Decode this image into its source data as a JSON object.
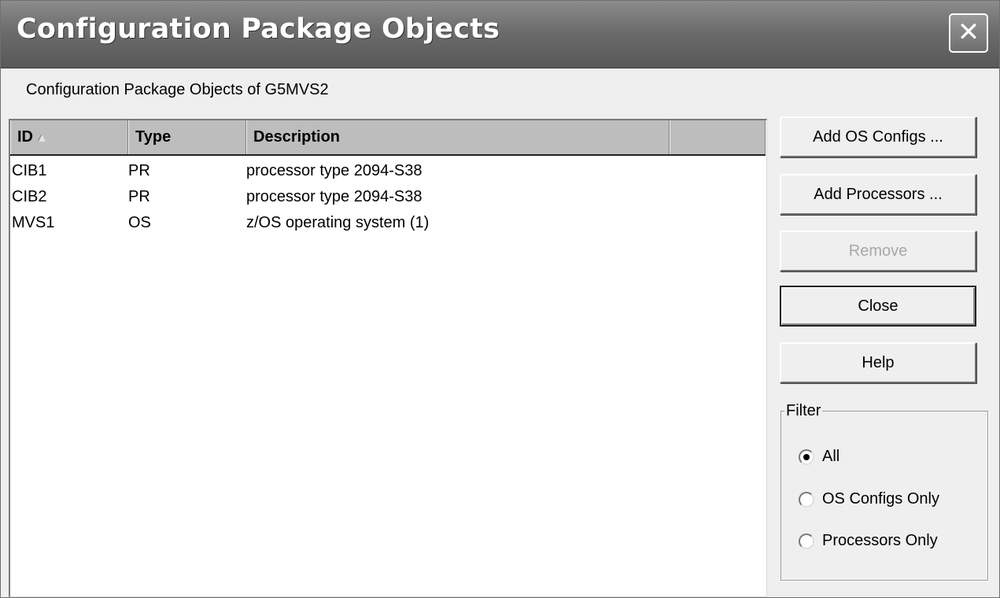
{
  "window": {
    "title": "Configuration Package Objects",
    "close_glyph": "✕"
  },
  "subtitle": "Configuration Package Objects of G5MVS2",
  "table": {
    "columns": [
      "ID",
      "Type",
      "Description",
      ""
    ],
    "sort_column": "ID",
    "sort_indicator": "▲",
    "rows": [
      {
        "id": "CIB1",
        "type": "PR",
        "description": "processor type 2094-S38"
      },
      {
        "id": "CIB2",
        "type": "PR",
        "description": "processor type 2094-S38"
      },
      {
        "id": "MVS1",
        "type": "OS",
        "description": "z/OS operating system (1)"
      }
    ]
  },
  "buttons": {
    "add_os_configs": "Add OS Configs ...",
    "add_processors": "Add Processors ...",
    "remove": "Remove",
    "close": "Close",
    "help": "Help"
  },
  "filter": {
    "legend": "Filter",
    "options": [
      "All",
      "OS Configs Only",
      "Processors Only"
    ],
    "selected": "All"
  }
}
